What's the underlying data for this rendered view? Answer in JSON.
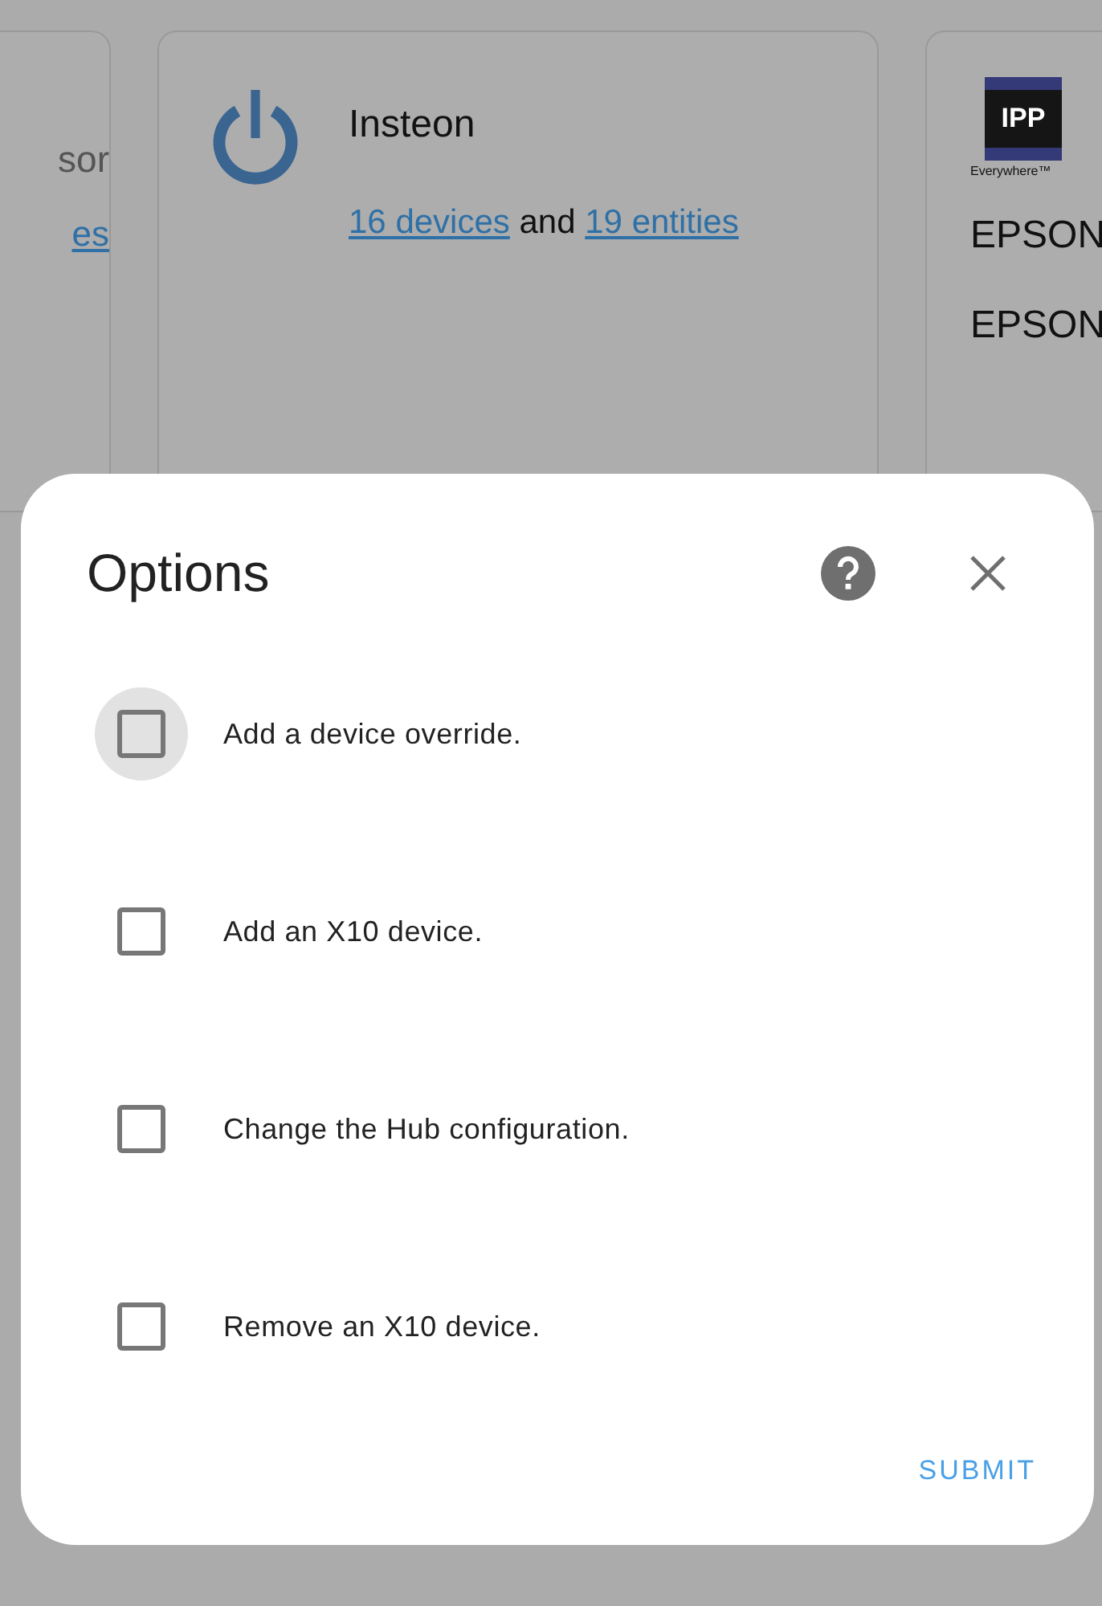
{
  "background_cards": {
    "left": {
      "subtitle": "sor",
      "link": "es"
    },
    "middle": {
      "title": "Insteon",
      "device_link": "16 devices",
      "joiner": "and",
      "entity_link": "19 entities"
    },
    "right": {
      "logo_text": "IPP",
      "logo_caption": "Everywhere™",
      "lines": [
        "EPSON",
        "EPSON"
      ]
    }
  },
  "dialog": {
    "title": "Options",
    "options": [
      {
        "label": "Add a device override.",
        "checked": false,
        "focused": true
      },
      {
        "label": "Add an X10 device.",
        "checked": false,
        "focused": false
      },
      {
        "label": "Change the Hub configuration.",
        "checked": false,
        "focused": false
      },
      {
        "label": "Remove an X10 device.",
        "checked": false,
        "focused": false
      }
    ],
    "submit": "SUBMIT"
  }
}
